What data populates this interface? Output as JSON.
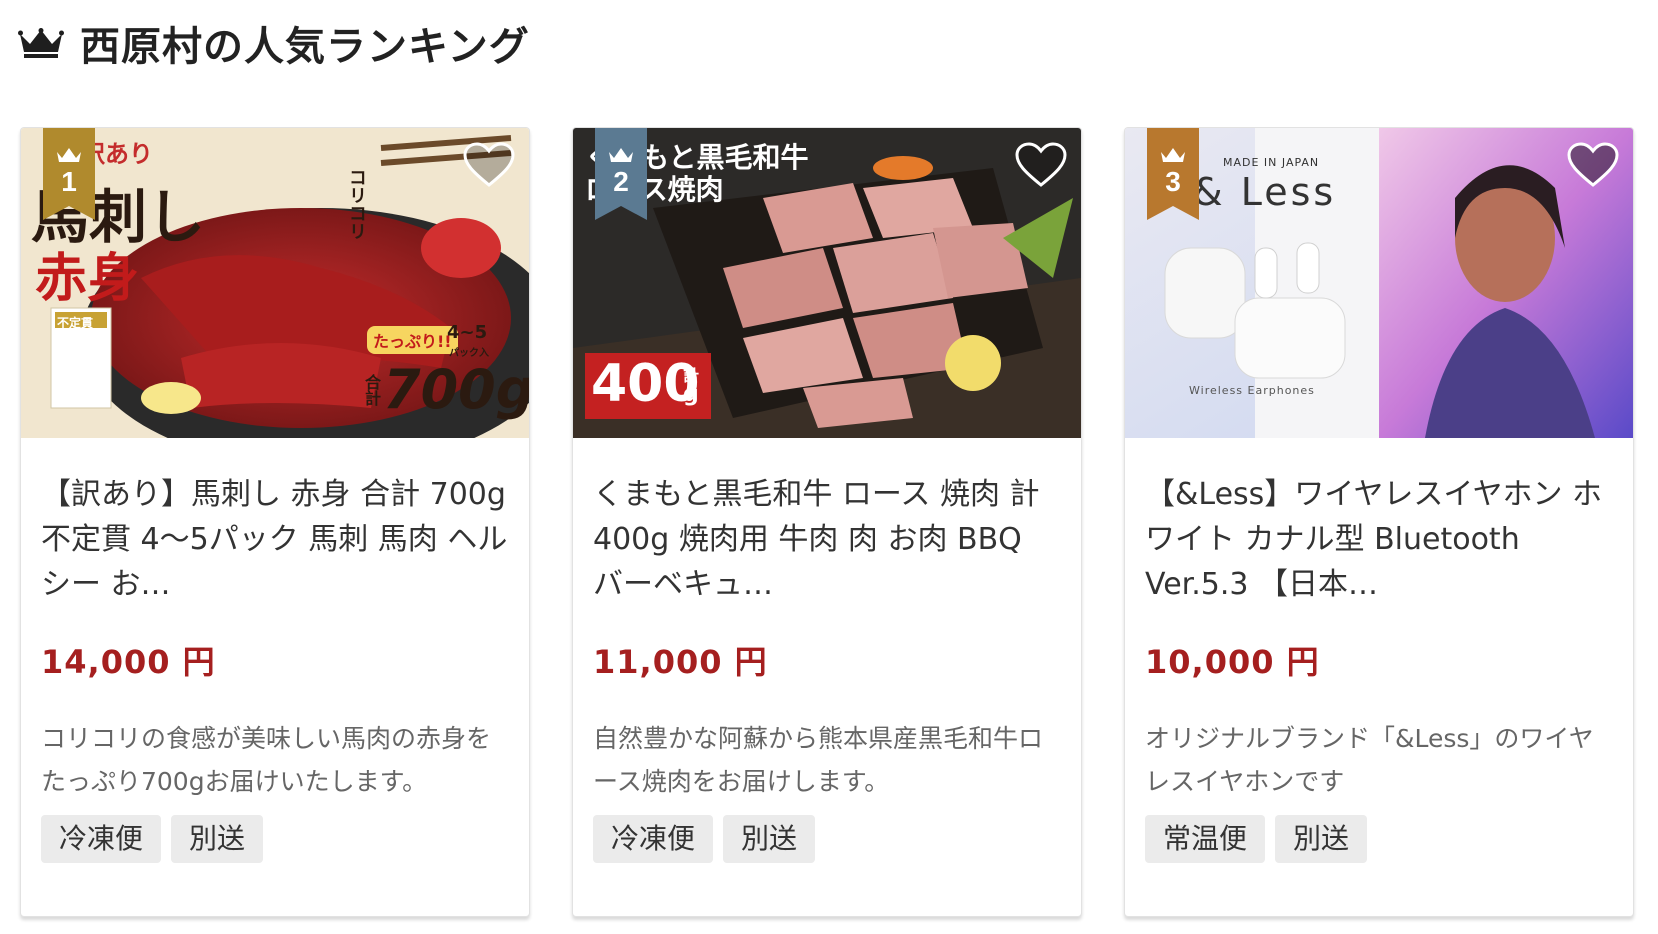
{
  "page": {
    "heading": "西原村の人気ランキング",
    "heading_icon": "crown-icon"
  },
  "colors": {
    "price": "#a51f1f",
    "rank_1": "#b08a2d",
    "rank_2": "#5b7a92",
    "rank_3": "#b8782e"
  },
  "products": [
    {
      "rank": "1",
      "image_text": {
        "badge_top": "訳あり",
        "main": "馬刺し",
        "sub": "赤身",
        "label": "不定貫",
        "side": "コリコリ",
        "tappuri": "たっぷり!!",
        "packs": "4~5",
        "packs_unit": "パック入",
        "total": "合計",
        "weight": "700g"
      },
      "title": "【訳あり】馬刺し 赤身 合計 700g 不定貫 4〜5パック 馬刺 馬肉 ヘルシー お…",
      "price": "14,000 円",
      "description": "コリコリの食感が美味しい馬肉の赤身をたっぷり700gお届けいたします。",
      "tags": [
        "冷凍便",
        "別送"
      ]
    },
    {
      "rank": "2",
      "image_text": {
        "line1": "くまもと黒毛和牛",
        "line2": "ロース焼肉",
        "weight": "400",
        "unit_top": "計",
        "unit_bottom": "g"
      },
      "title": "くまもと黒毛和牛 ロース 焼肉 計400g 焼肉用 牛肉 肉 お肉 BBQ バーベキュ…",
      "price": "11,000 円",
      "description": "自然豊かな阿蘇から熊本県産黒毛和牛ロース焼肉をお届けします。",
      "tags": [
        "冷凍便",
        "別送"
      ]
    },
    {
      "rank": "3",
      "image_text": {
        "made_in": "MADE IN JAPAN",
        "brand": "& Less",
        "caption": "Wireless Earphones"
      },
      "title": "【&Less】ワイヤレスイヤホン ホワイト カナル型 Bluetooth Ver.5.3 【日本…",
      "price": "10,000 円",
      "description": "オリジナルブランド「&Less」のワイヤレスイヤホンです",
      "tags": [
        "常温便",
        "別送"
      ]
    }
  ]
}
